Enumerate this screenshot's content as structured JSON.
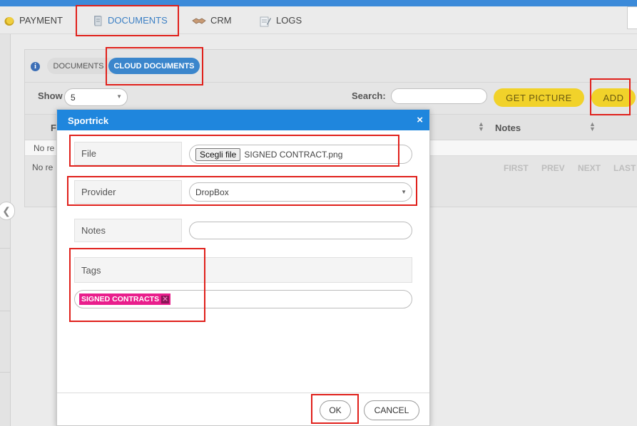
{
  "nav": {
    "items": [
      {
        "label": "PAYMENT",
        "icon": "coin-icon"
      },
      {
        "label": "DOCUMENTS",
        "icon": "document-icon"
      },
      {
        "label": "CRM",
        "icon": "handshake-icon"
      },
      {
        "label": "LOGS",
        "icon": "log-icon"
      }
    ],
    "active": "DOCUMENTS"
  },
  "panel": {
    "tabs": [
      "DOCUMENTS",
      "CLOUD DOCUMENTS"
    ],
    "active_tab": "CLOUD DOCUMENTS",
    "show_label": "Show",
    "show_value": "5",
    "search_label": "Search:",
    "search_value": "",
    "get_picture_label": "GET PICTURE",
    "add_label": "ADD",
    "column_first_initial": "F",
    "column_notes": "Notes",
    "no_records_1": "No re",
    "no_records_2": "No re",
    "pager": [
      "FIRST",
      "PREV",
      "NEXT",
      "LAST"
    ]
  },
  "modal": {
    "title": "Sportrick",
    "close_symbol": "×",
    "file_label": "File",
    "file_button": "Scegli file",
    "file_name": "SIGNED CONTRACT.png",
    "provider_label": "Provider",
    "provider_value": "DropBox",
    "notes_label": "Notes",
    "notes_value": "",
    "tags_label": "Tags",
    "tags": [
      "SIGNED CONTRACTS"
    ],
    "ok_label": "OK",
    "cancel_label": "CANCEL"
  },
  "colors": {
    "accent_blue": "#1f86dd",
    "tab_active": "#3b86cc",
    "button_yellow": "#f1d22a",
    "tag_pink": "#e91e8c",
    "highlight_red": "#e0201b"
  }
}
